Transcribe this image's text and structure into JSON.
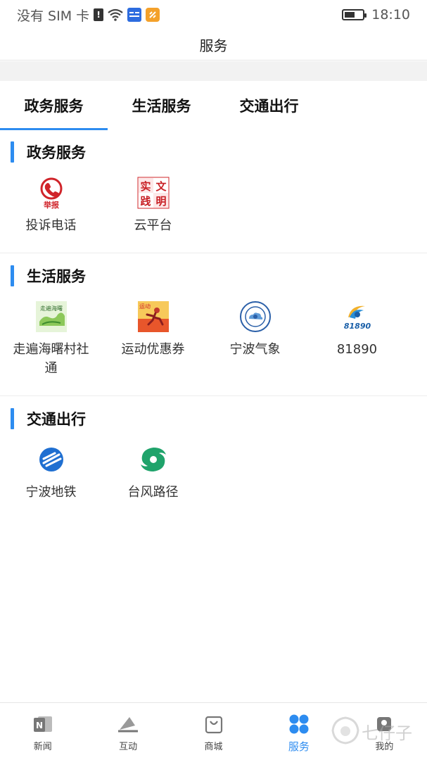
{
  "status_bar": {
    "carrier": "没有 SIM 卡",
    "time": "18:10",
    "battery_level": 0.6
  },
  "header": {
    "title": "服务"
  },
  "tabs": [
    {
      "label": "政务服务",
      "active": true
    },
    {
      "label": "生活服务",
      "active": false
    },
    {
      "label": "交通出行",
      "active": false
    }
  ],
  "sections": [
    {
      "title": "政务服务",
      "items": [
        {
          "label": "投诉电话",
          "icon": "report-phone-icon"
        },
        {
          "label": "云平台",
          "icon": "civilization-practice-icon"
        }
      ]
    },
    {
      "title": "生活服务",
      "items": [
        {
          "label": "走遍海曙村社通",
          "icon": "haishu-village-icon"
        },
        {
          "label": "运动优惠券",
          "icon": "sports-coupon-icon"
        },
        {
          "label": "宁波气象",
          "icon": "ningbo-weather-icon"
        },
        {
          "label": "81890",
          "icon": "service-81890-icon"
        }
      ]
    },
    {
      "title": "交通出行",
      "items": [
        {
          "label": "宁波地铁",
          "icon": "ningbo-metro-icon"
        },
        {
          "label": "台风路径",
          "icon": "typhoon-path-icon"
        }
      ]
    }
  ],
  "bottom_nav": [
    {
      "label": "新闻",
      "icon": "news-icon",
      "active": false
    },
    {
      "label": "互动",
      "icon": "interact-icon",
      "active": false
    },
    {
      "label": "商城",
      "icon": "shop-bag-icon",
      "active": false
    },
    {
      "label": "服务",
      "icon": "service-grid-icon",
      "active": true
    },
    {
      "label": "我的",
      "icon": "profile-icon",
      "active": false
    }
  ],
  "icon_texts": {
    "report": "举报",
    "practice": [
      "实",
      "文",
      "践",
      "明"
    ],
    "village": "走遍海曙",
    "coupon": "运动",
    "hotline": "81890"
  },
  "watermark": "七仔子",
  "colors": {
    "accent": "#2d8cf0",
    "report_red": "#d0242a",
    "typhoon_green": "#1fa36b"
  }
}
